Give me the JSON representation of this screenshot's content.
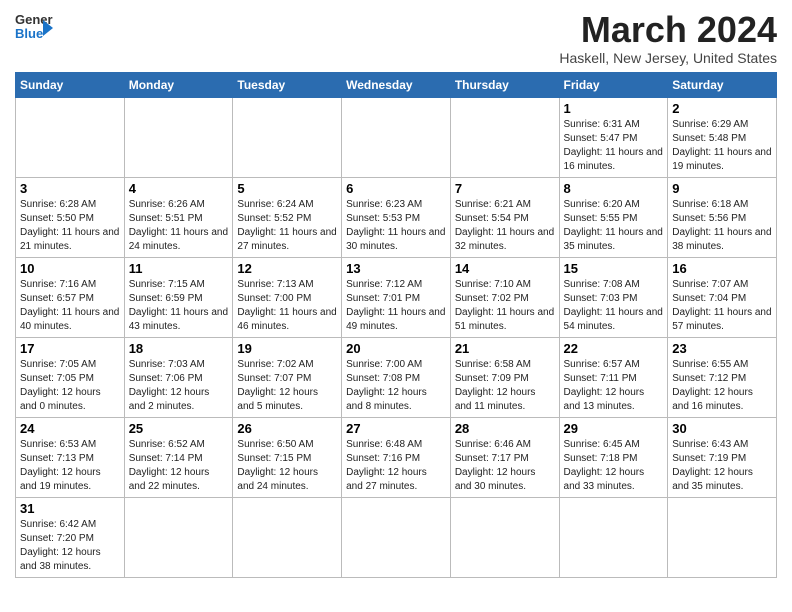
{
  "header": {
    "logo_general": "General",
    "logo_blue": "Blue",
    "month_title": "March 2024",
    "location": "Haskell, New Jersey, United States"
  },
  "weekdays": [
    "Sunday",
    "Monday",
    "Tuesday",
    "Wednesday",
    "Thursday",
    "Friday",
    "Saturday"
  ],
  "weeks": [
    [
      {
        "day": "",
        "info": ""
      },
      {
        "day": "",
        "info": ""
      },
      {
        "day": "",
        "info": ""
      },
      {
        "day": "",
        "info": ""
      },
      {
        "day": "",
        "info": ""
      },
      {
        "day": "1",
        "info": "Sunrise: 6:31 AM\nSunset: 5:47 PM\nDaylight: 11 hours and 16 minutes."
      },
      {
        "day": "2",
        "info": "Sunrise: 6:29 AM\nSunset: 5:48 PM\nDaylight: 11 hours and 19 minutes."
      }
    ],
    [
      {
        "day": "3",
        "info": "Sunrise: 6:28 AM\nSunset: 5:50 PM\nDaylight: 11 hours and 21 minutes."
      },
      {
        "day": "4",
        "info": "Sunrise: 6:26 AM\nSunset: 5:51 PM\nDaylight: 11 hours and 24 minutes."
      },
      {
        "day": "5",
        "info": "Sunrise: 6:24 AM\nSunset: 5:52 PM\nDaylight: 11 hours and 27 minutes."
      },
      {
        "day": "6",
        "info": "Sunrise: 6:23 AM\nSunset: 5:53 PM\nDaylight: 11 hours and 30 minutes."
      },
      {
        "day": "7",
        "info": "Sunrise: 6:21 AM\nSunset: 5:54 PM\nDaylight: 11 hours and 32 minutes."
      },
      {
        "day": "8",
        "info": "Sunrise: 6:20 AM\nSunset: 5:55 PM\nDaylight: 11 hours and 35 minutes."
      },
      {
        "day": "9",
        "info": "Sunrise: 6:18 AM\nSunset: 5:56 PM\nDaylight: 11 hours and 38 minutes."
      }
    ],
    [
      {
        "day": "10",
        "info": "Sunrise: 7:16 AM\nSunset: 6:57 PM\nDaylight: 11 hours and 40 minutes."
      },
      {
        "day": "11",
        "info": "Sunrise: 7:15 AM\nSunset: 6:59 PM\nDaylight: 11 hours and 43 minutes."
      },
      {
        "day": "12",
        "info": "Sunrise: 7:13 AM\nSunset: 7:00 PM\nDaylight: 11 hours and 46 minutes."
      },
      {
        "day": "13",
        "info": "Sunrise: 7:12 AM\nSunset: 7:01 PM\nDaylight: 11 hours and 49 minutes."
      },
      {
        "day": "14",
        "info": "Sunrise: 7:10 AM\nSunset: 7:02 PM\nDaylight: 11 hours and 51 minutes."
      },
      {
        "day": "15",
        "info": "Sunrise: 7:08 AM\nSunset: 7:03 PM\nDaylight: 11 hours and 54 minutes."
      },
      {
        "day": "16",
        "info": "Sunrise: 7:07 AM\nSunset: 7:04 PM\nDaylight: 11 hours and 57 minutes."
      }
    ],
    [
      {
        "day": "17",
        "info": "Sunrise: 7:05 AM\nSunset: 7:05 PM\nDaylight: 12 hours and 0 minutes."
      },
      {
        "day": "18",
        "info": "Sunrise: 7:03 AM\nSunset: 7:06 PM\nDaylight: 12 hours and 2 minutes."
      },
      {
        "day": "19",
        "info": "Sunrise: 7:02 AM\nSunset: 7:07 PM\nDaylight: 12 hours and 5 minutes."
      },
      {
        "day": "20",
        "info": "Sunrise: 7:00 AM\nSunset: 7:08 PM\nDaylight: 12 hours and 8 minutes."
      },
      {
        "day": "21",
        "info": "Sunrise: 6:58 AM\nSunset: 7:09 PM\nDaylight: 12 hours and 11 minutes."
      },
      {
        "day": "22",
        "info": "Sunrise: 6:57 AM\nSunset: 7:11 PM\nDaylight: 12 hours and 13 minutes."
      },
      {
        "day": "23",
        "info": "Sunrise: 6:55 AM\nSunset: 7:12 PM\nDaylight: 12 hours and 16 minutes."
      }
    ],
    [
      {
        "day": "24",
        "info": "Sunrise: 6:53 AM\nSunset: 7:13 PM\nDaylight: 12 hours and 19 minutes."
      },
      {
        "day": "25",
        "info": "Sunrise: 6:52 AM\nSunset: 7:14 PM\nDaylight: 12 hours and 22 minutes."
      },
      {
        "day": "26",
        "info": "Sunrise: 6:50 AM\nSunset: 7:15 PM\nDaylight: 12 hours and 24 minutes."
      },
      {
        "day": "27",
        "info": "Sunrise: 6:48 AM\nSunset: 7:16 PM\nDaylight: 12 hours and 27 minutes."
      },
      {
        "day": "28",
        "info": "Sunrise: 6:46 AM\nSunset: 7:17 PM\nDaylight: 12 hours and 30 minutes."
      },
      {
        "day": "29",
        "info": "Sunrise: 6:45 AM\nSunset: 7:18 PM\nDaylight: 12 hours and 33 minutes."
      },
      {
        "day": "30",
        "info": "Sunrise: 6:43 AM\nSunset: 7:19 PM\nDaylight: 12 hours and 35 minutes."
      }
    ],
    [
      {
        "day": "31",
        "info": "Sunrise: 6:42 AM\nSunset: 7:20 PM\nDaylight: 12 hours and 38 minutes."
      },
      {
        "day": "",
        "info": ""
      },
      {
        "day": "",
        "info": ""
      },
      {
        "day": "",
        "info": ""
      },
      {
        "day": "",
        "info": ""
      },
      {
        "day": "",
        "info": ""
      },
      {
        "day": "",
        "info": ""
      }
    ]
  ]
}
